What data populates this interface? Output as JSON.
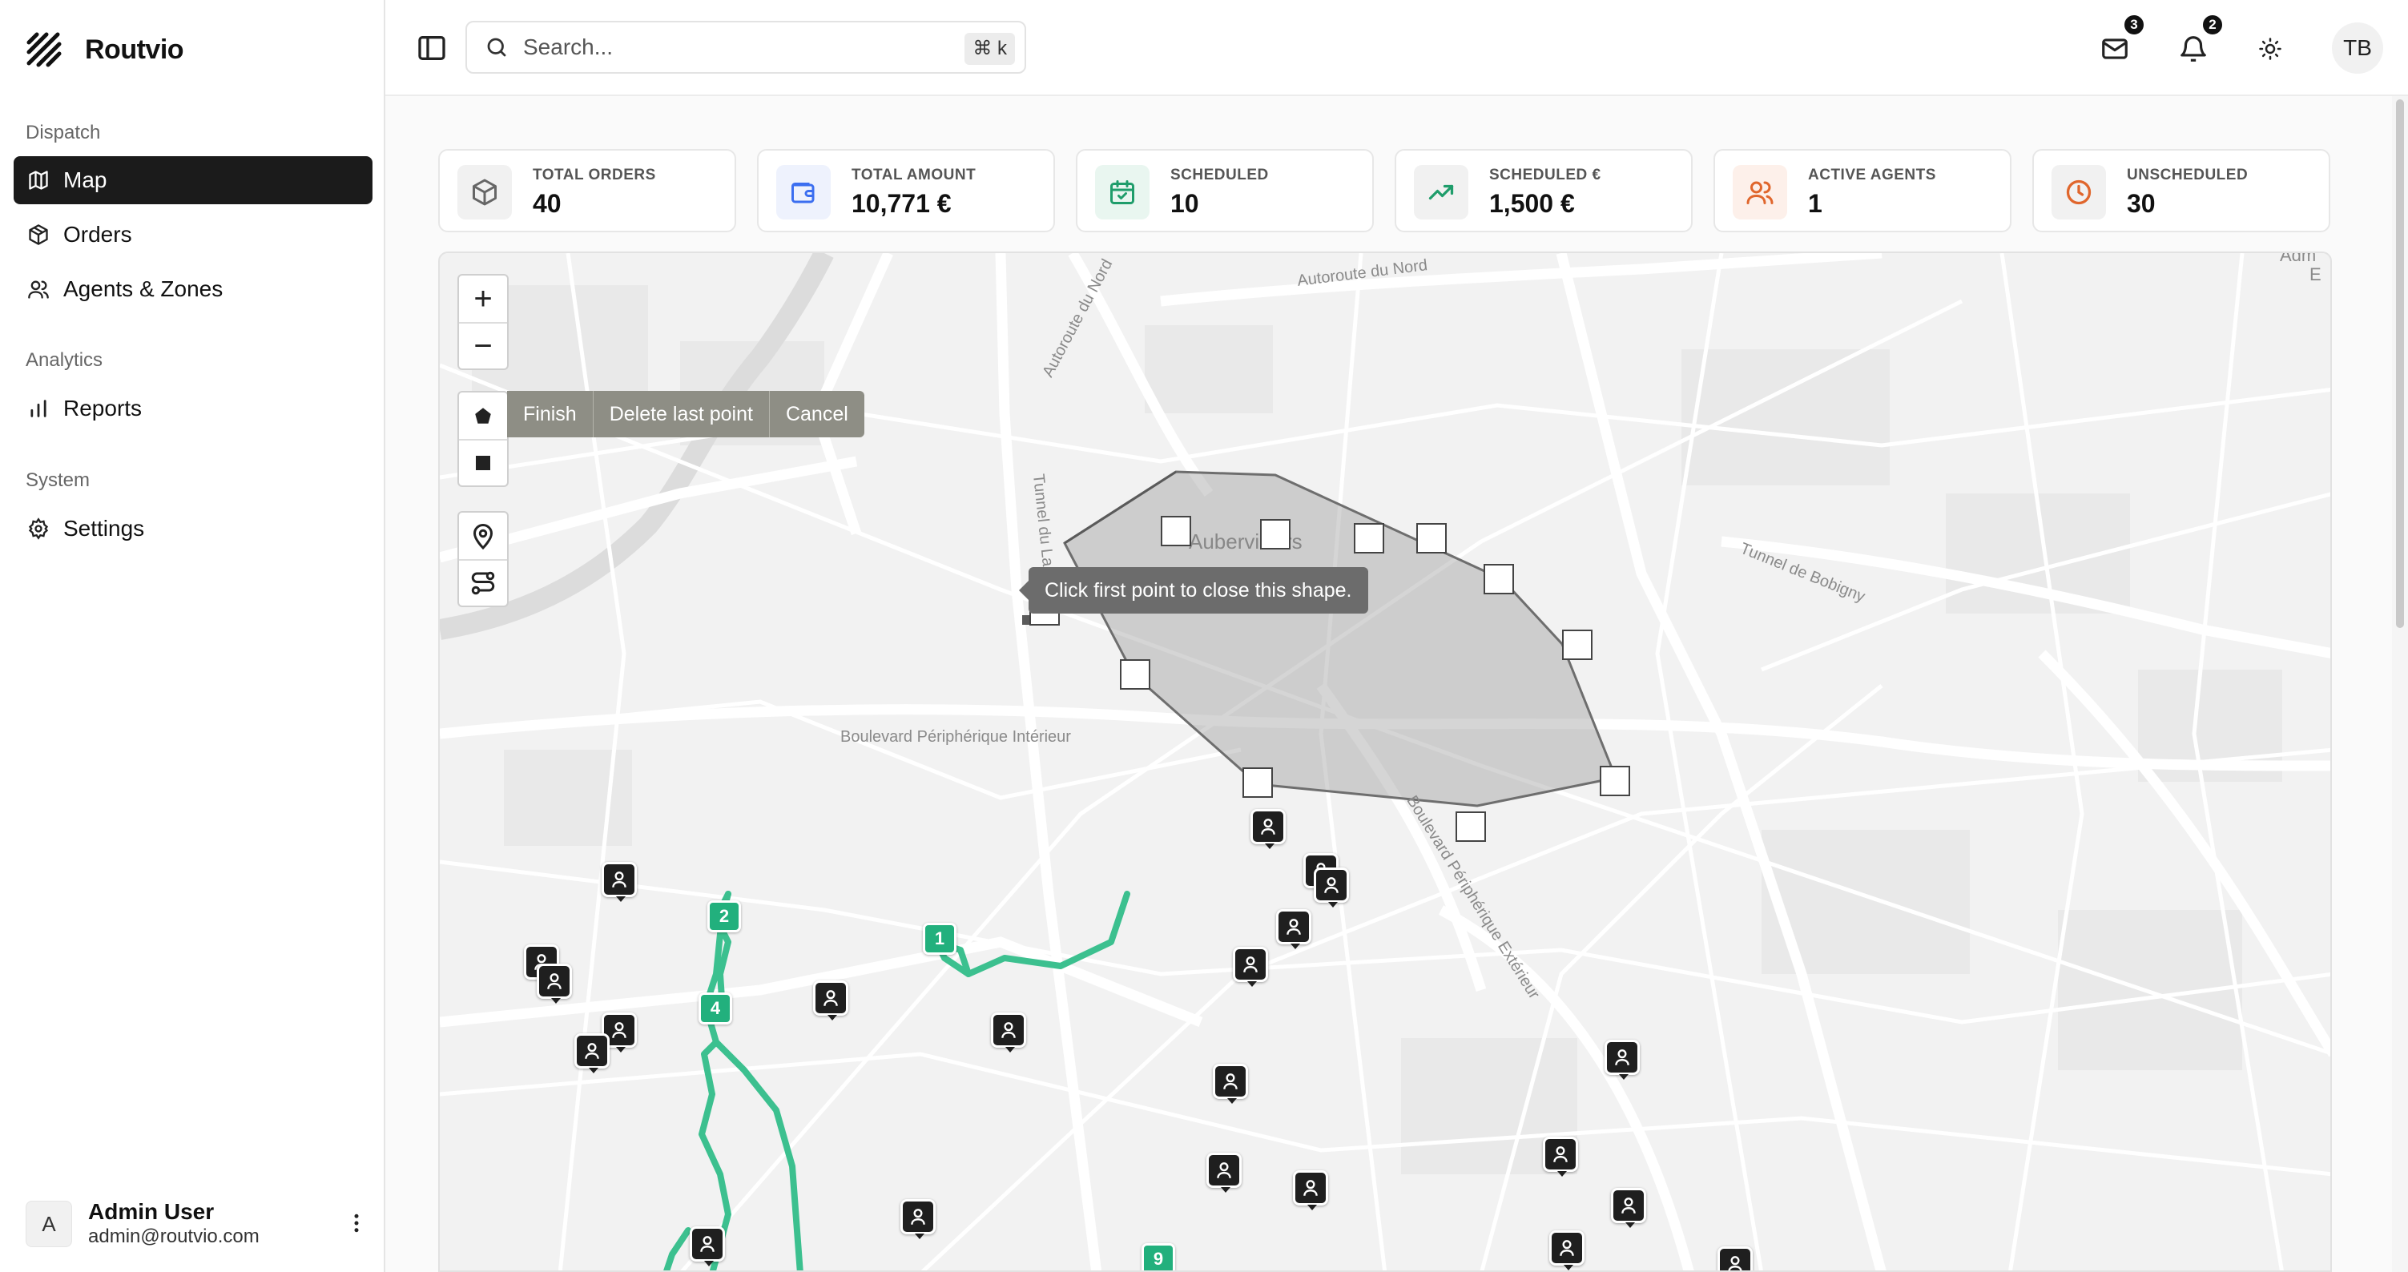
{
  "app": {
    "name": "Routvio"
  },
  "sidebar": {
    "sections": [
      {
        "title": "Dispatch",
        "items": [
          {
            "label": "Map",
            "icon": "map-icon",
            "active": true
          },
          {
            "label": "Orders",
            "icon": "package-icon"
          },
          {
            "label": "Agents & Zones",
            "icon": "users-icon"
          }
        ]
      },
      {
        "title": "Analytics",
        "items": [
          {
            "label": "Reports",
            "icon": "bar-chart-icon"
          }
        ]
      },
      {
        "title": "System",
        "items": [
          {
            "label": "Settings",
            "icon": "gear-icon"
          }
        ]
      }
    ],
    "user": {
      "initial": "A",
      "name": "Admin User",
      "email": "admin@routvio.com"
    }
  },
  "header": {
    "search": {
      "placeholder": "Search...",
      "shortcut": "⌘ k"
    },
    "mail_badge": "3",
    "notifications_badge": "2",
    "avatar_initials": "TB"
  },
  "stats": [
    {
      "label": "TOTAL ORDERS",
      "value": "40",
      "icon": "box-icon",
      "color": "#666666",
      "bg": "#f1f1f1"
    },
    {
      "label": "TOTAL AMOUNT",
      "value": "10,771 €",
      "icon": "wallet-icon",
      "color": "#3b6ef0",
      "bg": "#eef2fd"
    },
    {
      "label": "SCHEDULED",
      "value": "10",
      "icon": "calendar-check-icon",
      "color": "#1f9d6b",
      "bg": "#e9f6f0"
    },
    {
      "label": "SCHEDULED €",
      "value": "1,500 €",
      "icon": "trending-up-icon",
      "color": "#1f9d6b",
      "bg": "#f1f1f1"
    },
    {
      "label": "ACTIVE AGENTS",
      "value": "1",
      "icon": "users-icon",
      "color": "#e0662c",
      "bg": "#fdf0ea"
    },
    {
      "label": "UNSCHEDULED",
      "value": "30",
      "icon": "clock-icon",
      "color": "#e0662c",
      "bg": "#f1f1f1"
    }
  ],
  "map": {
    "zoom_in": "+",
    "zoom_out": "−",
    "draw_actions": {
      "finish": "Finish",
      "delete_last": "Delete last point",
      "cancel": "Cancel"
    },
    "tooltip": "Click first point to close this shape.",
    "labels": {
      "autoroute_nord": "Autoroute du Nord",
      "autoroute_nord_2": "Autoroute du Nord",
      "tunnel_landy": "Tunnel du Landy",
      "aubervilliers": "Aubervilliers",
      "tunnel_bobigny": "Tunnel de Bobigny",
      "bd_peripherique_int": "Boulevard Périphérique Intérieur",
      "bd_peripherique_ext": "Boulevard Périphérique Extérieur",
      "corner_1": "Adm",
      "corner_2": "E"
    },
    "route_stops": [
      "1",
      "2",
      "4",
      "9"
    ],
    "route_color": "#3cc08f",
    "zone_fill": "#9a9a9a"
  }
}
